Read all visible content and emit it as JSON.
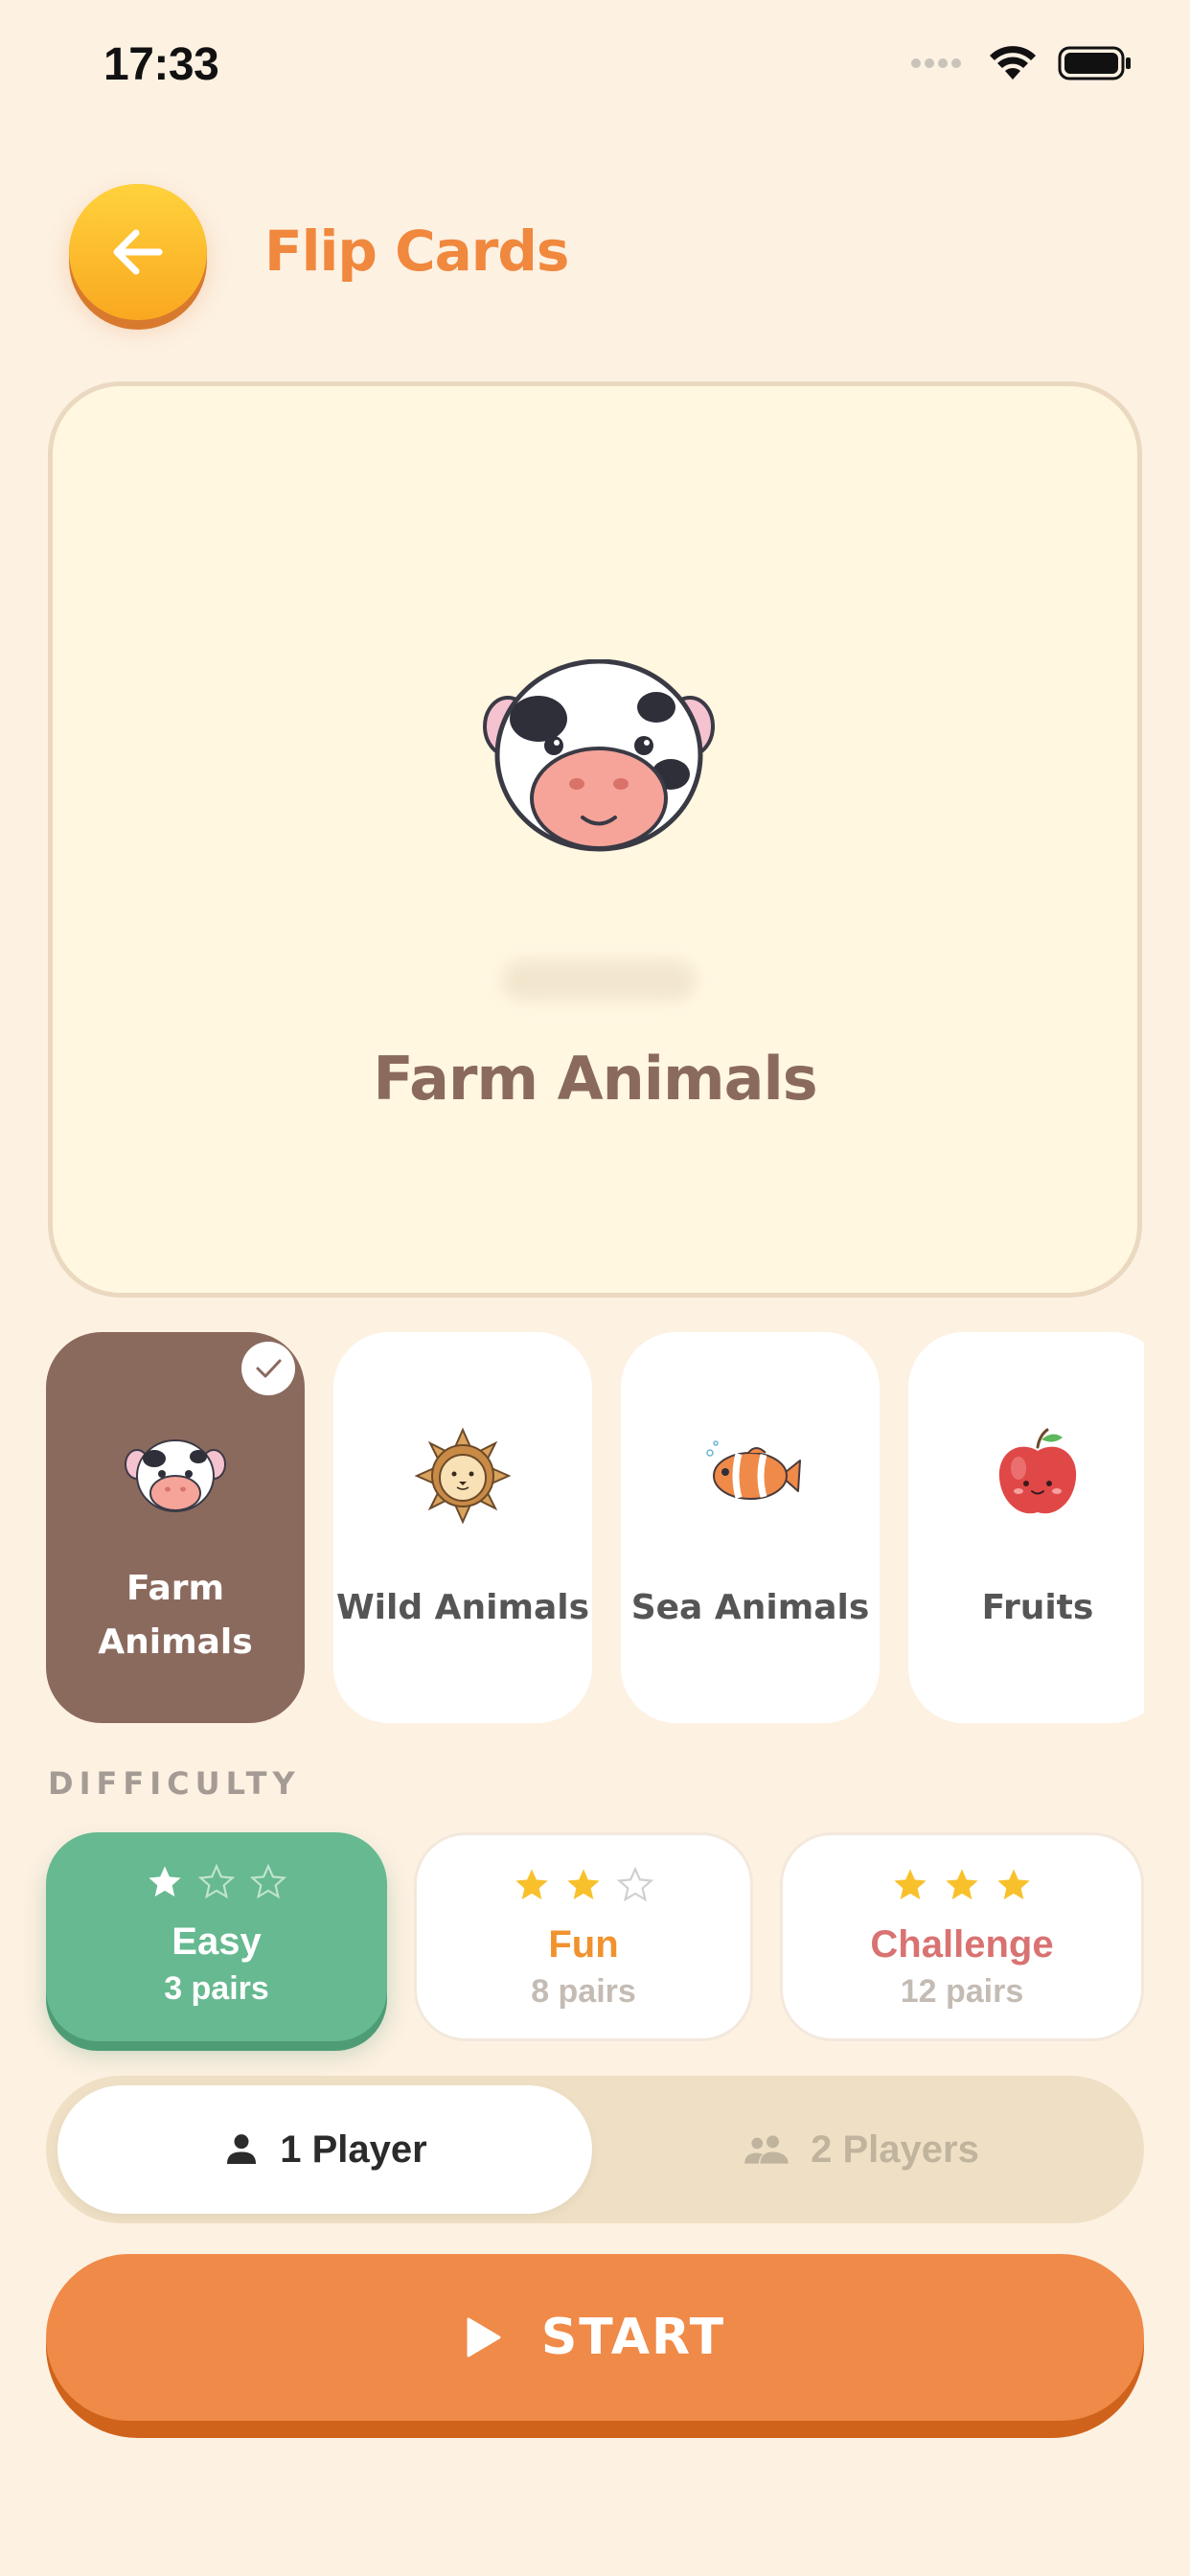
{
  "status_bar": {
    "time": "17:33",
    "icons": [
      "signal-icon",
      "wifi-icon",
      "battery-icon"
    ]
  },
  "header": {
    "back_icon": "arrow-left-icon",
    "title": "Flip Cards"
  },
  "preview": {
    "icon": "cow-face-icon",
    "title": "Farm Animals"
  },
  "categories": [
    {
      "label": "Farm Animals",
      "icon": "cow-face-icon",
      "selected": true
    },
    {
      "label": "Wild Animals",
      "icon": "lion-face-icon",
      "selected": false
    },
    {
      "label": "Sea Animals",
      "icon": "clownfish-icon",
      "selected": false
    },
    {
      "label": "Fruits",
      "icon": "apple-icon",
      "selected": false
    }
  ],
  "difficulty": {
    "label": "DIFFICULTY",
    "options": [
      {
        "name": "Easy",
        "pairs": "3 pairs",
        "stars": 1,
        "color": "#ffffff",
        "selected": true
      },
      {
        "name": "Fun",
        "pairs": "8 pairs",
        "stars": 2,
        "color": "#f0922e",
        "selected": false
      },
      {
        "name": "Challenge",
        "pairs": "12 pairs",
        "stars": 3,
        "color": "#d97272",
        "selected": false
      }
    ]
  },
  "players": {
    "one": {
      "label": "1 Player",
      "icon": "person-icon",
      "selected": true
    },
    "two": {
      "label": "2 Players",
      "icon": "people-icon",
      "selected": false
    }
  },
  "start": {
    "label": "START",
    "icon": "play-icon"
  },
  "colors": {
    "background": "#fdf1e2",
    "accent_orange": "#f08a48",
    "selected_brown": "#8b6a5e",
    "easy_green": "#66b990",
    "star_gold": "#f8c12c"
  }
}
